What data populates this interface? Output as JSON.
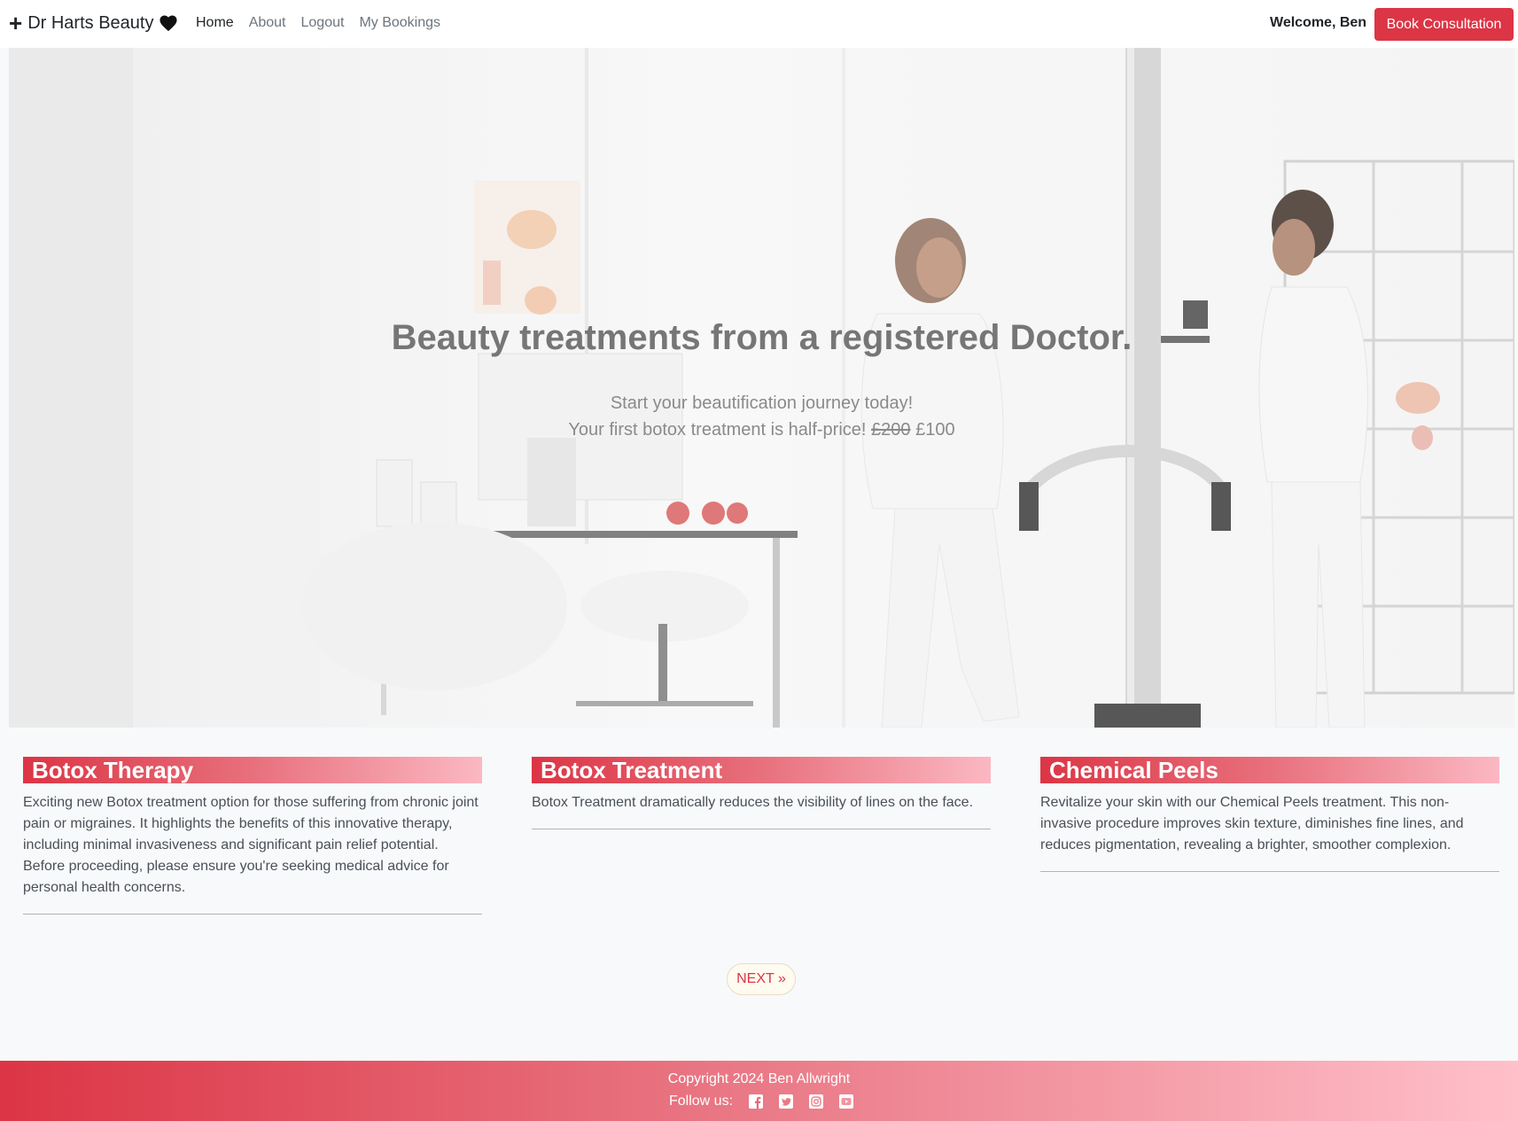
{
  "navbar": {
    "brand": "Dr Harts Beauty",
    "links": [
      {
        "label": "Home",
        "active": true
      },
      {
        "label": "About",
        "active": false
      },
      {
        "label": "Logout",
        "active": false
      },
      {
        "label": "My Bookings",
        "active": false
      }
    ],
    "welcome": "Welcome, Ben",
    "book_button": "Book Consultation"
  },
  "hero": {
    "title": "Beauty treatments from a registered Doctor.",
    "subtitle_line1": "Start your beautification journey today!",
    "subtitle_line2_prefix": "Your first botox treatment is half-price!",
    "old_price": "£200",
    "new_price": "£100"
  },
  "cards": [
    {
      "title": "Botox Therapy",
      "description": "Exciting new Botox treatment option for those suffering from chronic joint pain or migraines. It highlights the benefits of this innovative therapy, including minimal invasiveness and significant pain relief potential. Before proceeding, please ensure you're seeking medical advice for personal health concerns."
    },
    {
      "title": "Botox Treatment",
      "description": "Botox Treatment dramatically reduces the visibility of lines on the face."
    },
    {
      "title": "Chemical Peels",
      "description": "Revitalize your skin with our Chemical Peels treatment. This non-invasive procedure improves skin texture, diminishes fine lines, and reduces pigmentation, revealing a brighter, smoother complexion."
    }
  ],
  "pagination": {
    "next_label": "NEXT »"
  },
  "footer": {
    "copyright": "Copyright 2024 Ben Allwright",
    "follow_label": "Follow us:",
    "social_icons": [
      "facebook-icon",
      "twitter-icon",
      "instagram-icon",
      "youtube-icon"
    ]
  },
  "colors": {
    "accent": "#dc3545",
    "footer_end": "#ffc0ca"
  }
}
